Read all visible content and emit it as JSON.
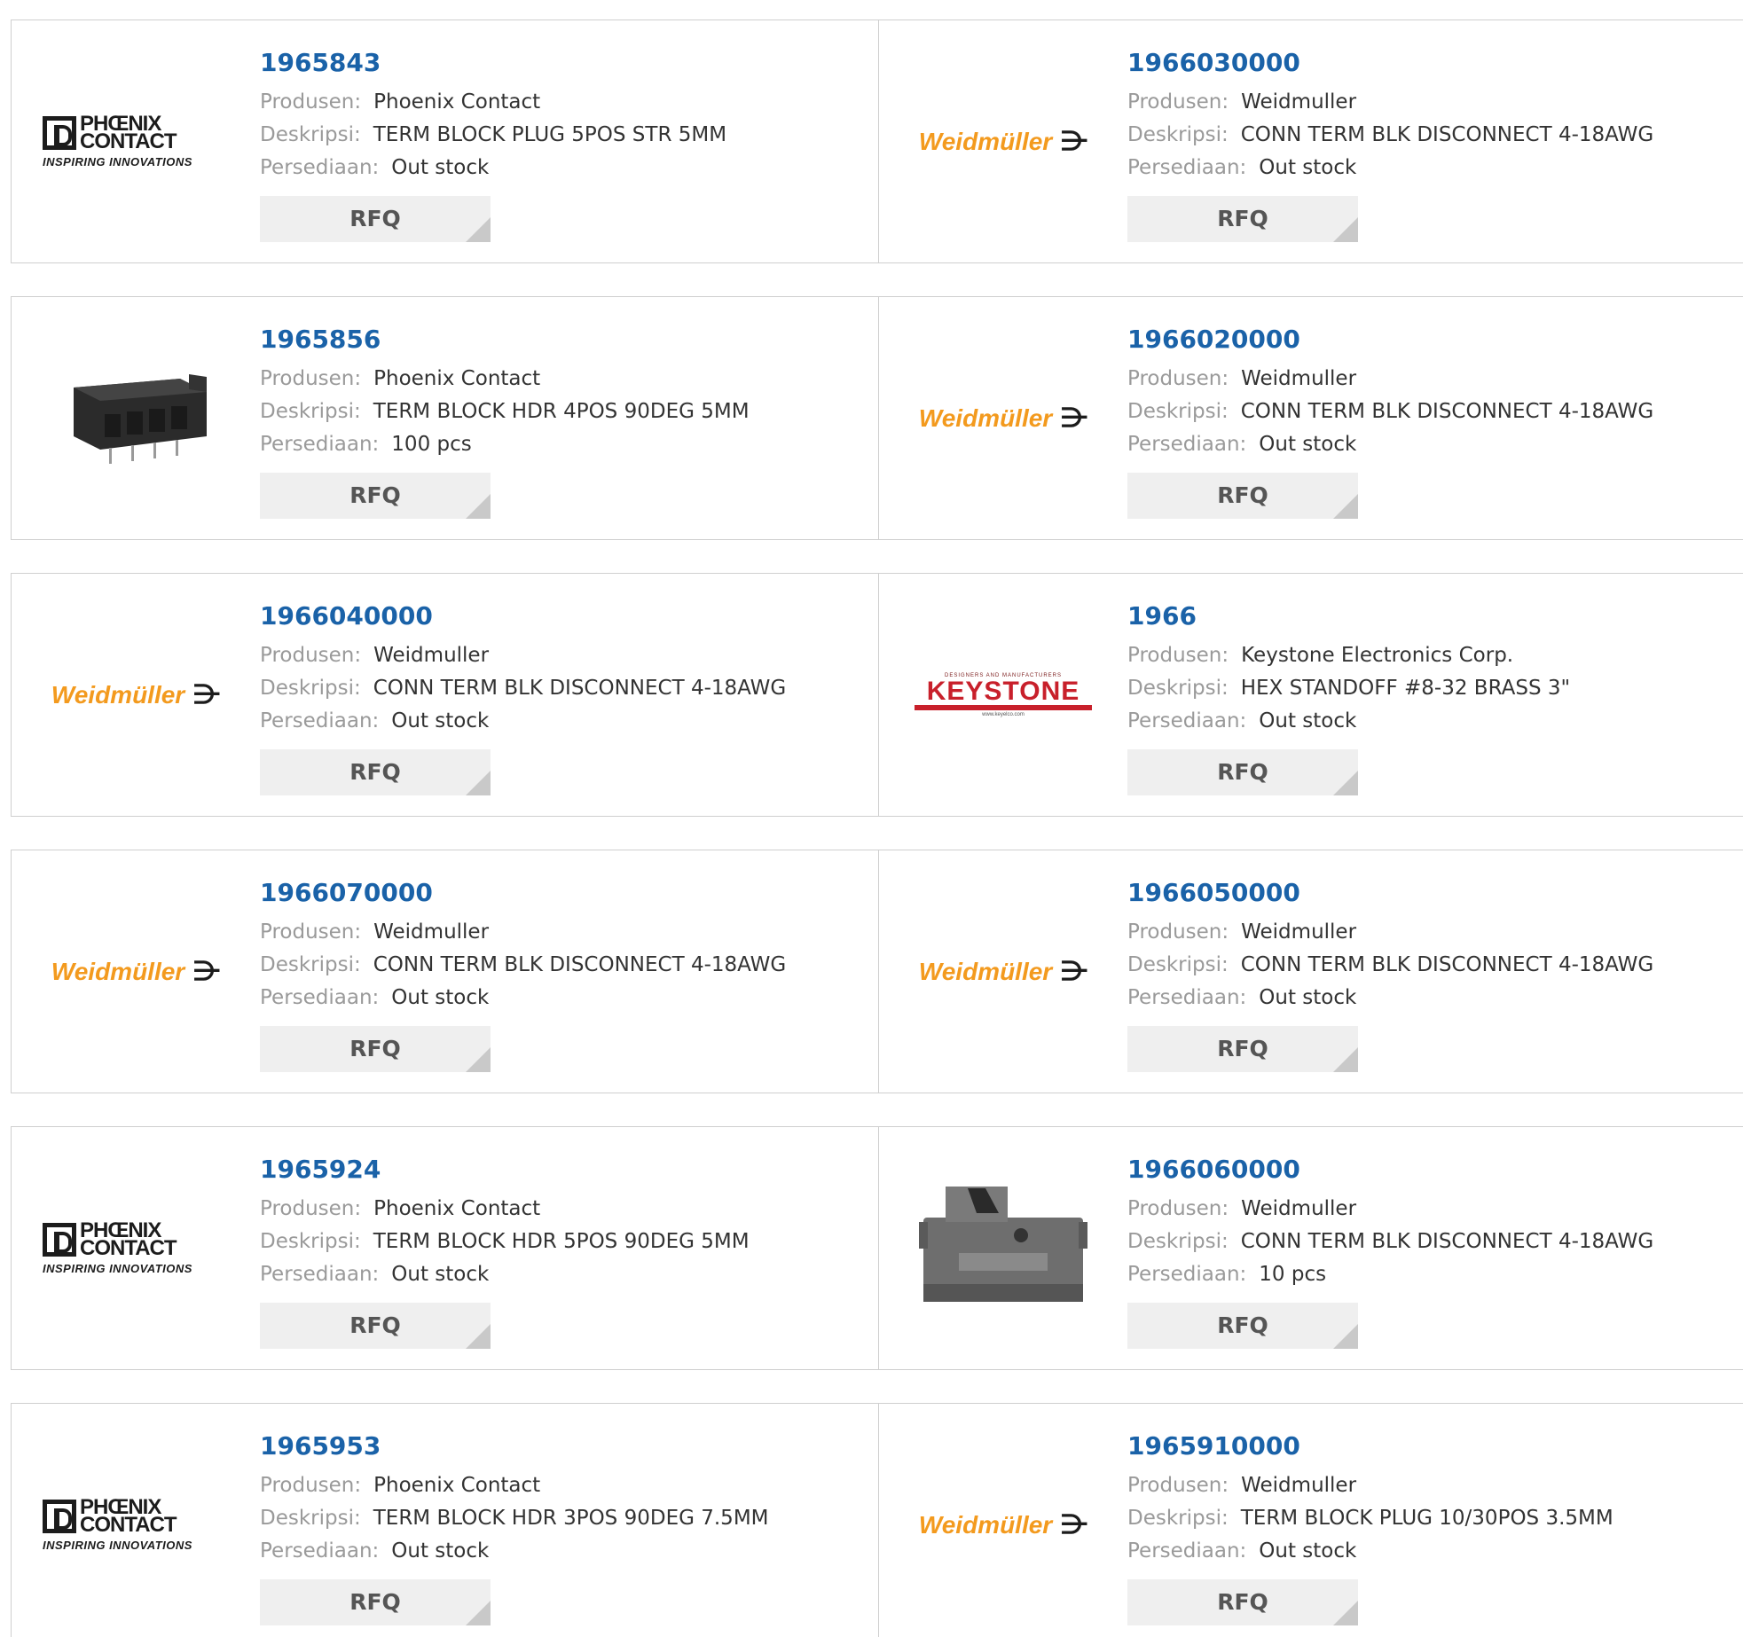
{
  "labels": {
    "manufacturer": "Produsen:",
    "description": "Deskripsi:",
    "stock": "Persediaan:",
    "rfq": "RFQ"
  },
  "logo_text": {
    "phoenix_line1": "PHŒNIX",
    "phoenix_line2": "CONTACT",
    "phoenix_tagline": "INSPIRING INNOVATIONS",
    "weidmuller": "Weidmüller",
    "weidmuller_mark": "⋺",
    "keystone_small": "DESIGNERS AND MANUFACTURERS",
    "keystone": "KEYSTONE",
    "keystone_sub": "www.keyelco.com"
  },
  "colors": {
    "part_link": "#1a62a8",
    "label_grey": "#9a9a9a",
    "value_dark": "#333333",
    "rfq_bg": "#efefef",
    "weidmuller_orange": "#f39a1e",
    "keystone_red": "#c8202b"
  },
  "products": [
    {
      "part": "1965843",
      "manufacturer": "Phoenix Contact",
      "description": "TERM BLOCK PLUG 5POS STR 5MM",
      "stock": "Out stock",
      "logo": "phoenix"
    },
    {
      "part": "1966030000",
      "manufacturer": "Weidmuller",
      "description": "CONN TERM BLK DISCONNECT 4-18AWG",
      "stock": "Out stock",
      "logo": "weidmuller"
    },
    {
      "part": "1965856",
      "manufacturer": "Phoenix Contact",
      "description": "TERM BLOCK HDR 4POS 90DEG 5MM",
      "stock": "100 pcs",
      "logo": "photo-header"
    },
    {
      "part": "1966020000",
      "manufacturer": "Weidmuller",
      "description": "CONN TERM BLK DISCONNECT 4-18AWG",
      "stock": "Out stock",
      "logo": "weidmuller"
    },
    {
      "part": "1966040000",
      "manufacturer": "Weidmuller",
      "description": "CONN TERM BLK DISCONNECT 4-18AWG",
      "stock": "Out stock",
      "logo": "weidmuller"
    },
    {
      "part": "1966",
      "manufacturer": "Keystone Electronics Corp.",
      "description": "HEX STANDOFF #8-32 BRASS 3\"",
      "stock": "Out stock",
      "logo": "keystone"
    },
    {
      "part": "1966070000",
      "manufacturer": "Weidmuller",
      "description": "CONN TERM BLK DISCONNECT 4-18AWG",
      "stock": "Out stock",
      "logo": "weidmuller"
    },
    {
      "part": "1966050000",
      "manufacturer": "Weidmuller",
      "description": "CONN TERM BLK DISCONNECT 4-18AWG",
      "stock": "Out stock",
      "logo": "weidmuller"
    },
    {
      "part": "1965924",
      "manufacturer": "Phoenix Contact",
      "description": "TERM BLOCK HDR 5POS 90DEG 5MM",
      "stock": "Out stock",
      "logo": "phoenix"
    },
    {
      "part": "1966060000",
      "manufacturer": "Weidmuller",
      "description": "CONN TERM BLK DISCONNECT 4-18AWG",
      "stock": "10 pcs",
      "logo": "photo-disconnect"
    },
    {
      "part": "1965953",
      "manufacturer": "Phoenix Contact",
      "description": "TERM BLOCK HDR 3POS 90DEG 7.5MM",
      "stock": "Out stock",
      "logo": "phoenix"
    },
    {
      "part": "1965910000",
      "manufacturer": "Weidmuller",
      "description": "TERM BLOCK PLUG 10/30POS 3.5MM",
      "stock": "Out stock",
      "logo": "weidmuller"
    }
  ]
}
